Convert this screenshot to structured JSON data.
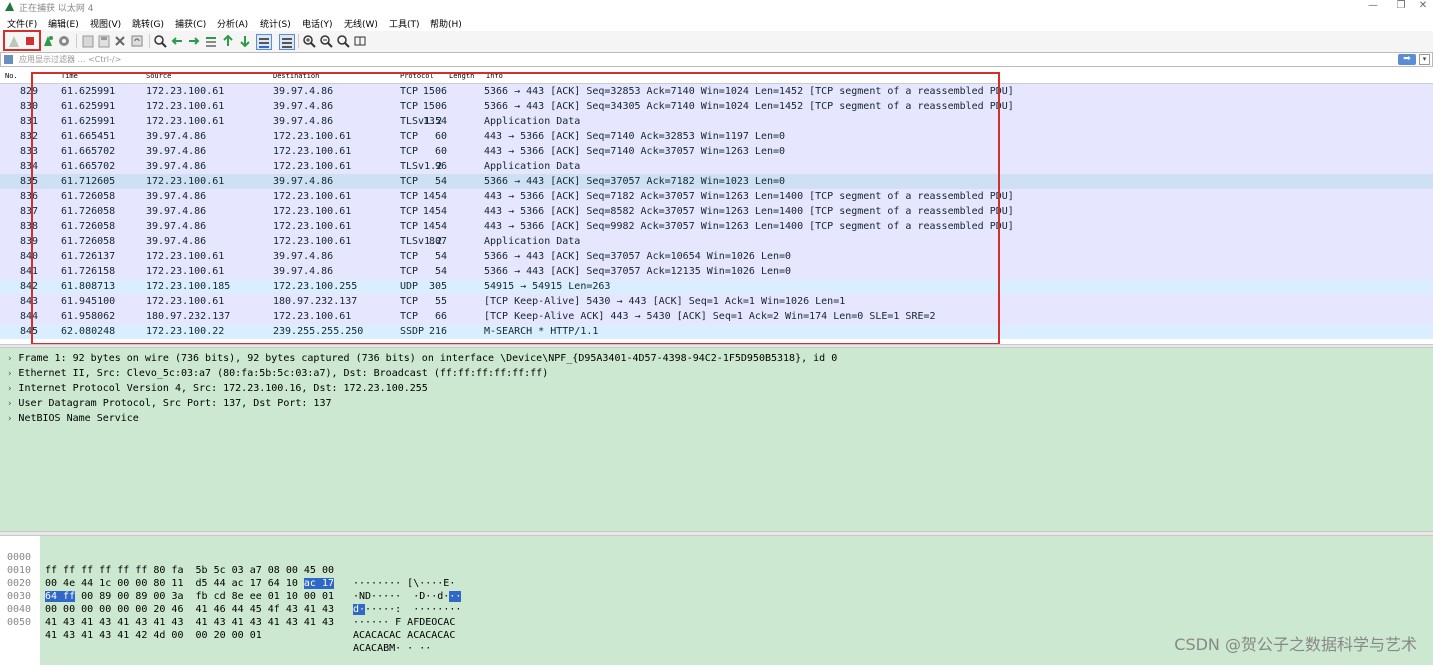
{
  "window": {
    "title": "正在捕获 以太网 4"
  },
  "menu": [
    "文件(F)",
    "编辑(E)",
    "视图(V)",
    "跳转(G)",
    "捕获(C)",
    "分析(A)",
    "统计(S)",
    "电话(Y)",
    "无线(W)",
    "工具(T)",
    "帮助(H)"
  ],
  "filter": {
    "placeholder": "应用显示过滤器 … <Ctrl-/>"
  },
  "columns": {
    "no": "No.",
    "time": "Time",
    "source": "Source",
    "destination": "Destination",
    "protocol": "Protocol",
    "length": "Length",
    "info": "Info"
  },
  "packets": [
    {
      "no": "829",
      "time": "61.625991",
      "src": "172.23.100.61",
      "dst": "39.97.4.86",
      "proto": "TCP",
      "len": "1506",
      "info": "5366 → 443 [ACK] Seq=32853 Ack=7140 Win=1024 Len=1452 [TCP segment of a reassembled PDU]",
      "color": "#e7e6ff"
    },
    {
      "no": "830",
      "time": "61.625991",
      "src": "172.23.100.61",
      "dst": "39.97.4.86",
      "proto": "TCP",
      "len": "1506",
      "info": "5366 → 443 [ACK] Seq=34305 Ack=7140 Win=1024 Len=1452 [TCP segment of a reassembled PDU]",
      "color": "#e7e6ff"
    },
    {
      "no": "831",
      "time": "61.625991",
      "src": "172.23.100.61",
      "dst": "39.97.4.86",
      "proto": "TLSv1.2",
      "len": "1354",
      "info": "Application Data",
      "color": "#e7e6ff"
    },
    {
      "no": "832",
      "time": "61.665451",
      "src": "39.97.4.86",
      "dst": "172.23.100.61",
      "proto": "TCP",
      "len": "60",
      "info": "443 → 5366 [ACK] Seq=7140 Ack=32853 Win=1197 Len=0",
      "color": "#e7e6ff"
    },
    {
      "no": "833",
      "time": "61.665702",
      "src": "39.97.4.86",
      "dst": "172.23.100.61",
      "proto": "TCP",
      "len": "60",
      "info": "443 → 5366 [ACK] Seq=7140 Ack=37057 Win=1263 Len=0",
      "color": "#e7e6ff"
    },
    {
      "no": "834",
      "time": "61.665702",
      "src": "39.97.4.86",
      "dst": "172.23.100.61",
      "proto": "TLSv1.2",
      "len": "96",
      "info": "Application Data",
      "color": "#e7e6ff"
    },
    {
      "no": "835",
      "time": "61.712605",
      "src": "172.23.100.61",
      "dst": "39.97.4.86",
      "proto": "TCP",
      "len": "54",
      "info": "5366 → 443 [ACK] Seq=37057 Ack=7182 Win=1023 Len=0",
      "color": "#cfe0f5"
    },
    {
      "no": "836",
      "time": "61.726058",
      "src": "39.97.4.86",
      "dst": "172.23.100.61",
      "proto": "TCP",
      "len": "1454",
      "info": "443 → 5366 [ACK] Seq=7182 Ack=37057 Win=1263 Len=1400 [TCP segment of a reassembled PDU]",
      "color": "#e7e6ff"
    },
    {
      "no": "837",
      "time": "61.726058",
      "src": "39.97.4.86",
      "dst": "172.23.100.61",
      "proto": "TCP",
      "len": "1454",
      "info": "443 → 5366 [ACK] Seq=8582 Ack=37057 Win=1263 Len=1400 [TCP segment of a reassembled PDU]",
      "color": "#e7e6ff"
    },
    {
      "no": "838",
      "time": "61.726058",
      "src": "39.97.4.86",
      "dst": "172.23.100.61",
      "proto": "TCP",
      "len": "1454",
      "info": "443 → 5366 [ACK] Seq=9982 Ack=37057 Win=1263 Len=1400 [TCP segment of a reassembled PDU]",
      "color": "#e7e6ff"
    },
    {
      "no": "839",
      "time": "61.726058",
      "src": "39.97.4.86",
      "dst": "172.23.100.61",
      "proto": "TLSv1.2",
      "len": "807",
      "info": "Application Data",
      "color": "#e7e6ff"
    },
    {
      "no": "840",
      "time": "61.726137",
      "src": "172.23.100.61",
      "dst": "39.97.4.86",
      "proto": "TCP",
      "len": "54",
      "info": "5366 → 443 [ACK] Seq=37057 Ack=10654 Win=1026 Len=0",
      "color": "#e7e6ff"
    },
    {
      "no": "841",
      "time": "61.726158",
      "src": "172.23.100.61",
      "dst": "39.97.4.86",
      "proto": "TCP",
      "len": "54",
      "info": "5366 → 443 [ACK] Seq=37057 Ack=12135 Win=1026 Len=0",
      "color": "#e7e6ff"
    },
    {
      "no": "842",
      "time": "61.808713",
      "src": "172.23.100.185",
      "dst": "172.23.100.255",
      "proto": "UDP",
      "len": "305",
      "info": "54915 → 54915 Len=263",
      "color": "#daeeff"
    },
    {
      "no": "843",
      "time": "61.945100",
      "src": "172.23.100.61",
      "dst": "180.97.232.137",
      "proto": "TCP",
      "len": "55",
      "info": "[TCP Keep-Alive] 5430 → 443 [ACK] Seq=1 Ack=1 Win=1026 Len=1",
      "color": "#e7e6ff"
    },
    {
      "no": "844",
      "time": "61.958062",
      "src": "180.97.232.137",
      "dst": "172.23.100.61",
      "proto": "TCP",
      "len": "66",
      "info": "[TCP Keep-Alive ACK] 443 → 5430 [ACK] Seq=1 Ack=2 Win=174 Len=0 SLE=1 SRE=2",
      "color": "#e7e6ff"
    },
    {
      "no": "845",
      "time": "62.080248",
      "src": "172.23.100.22",
      "dst": "239.255.255.250",
      "proto": "SSDP",
      "len": "216",
      "info": "M-SEARCH * HTTP/1.1",
      "color": "#daeeff"
    }
  ],
  "details": [
    "Frame 1: 92 bytes on wire (736 bits), 92 bytes captured (736 bits) on interface \\Device\\NPF_{D95A3401-4D57-4398-94C2-1F5D950B5318}, id 0",
    "Ethernet II, Src: Clevo_5c:03:a7 (80:fa:5b:5c:03:a7), Dst: Broadcast (ff:ff:ff:ff:ff:ff)",
    "Internet Protocol Version 4, Src: 172.23.100.16, Dst: 172.23.100.255",
    "User Datagram Protocol, Src Port: 137, Dst Port: 137",
    "NetBIOS Name Service"
  ],
  "bytes": [
    {
      "off": "0000",
      "hex": "ff ff ff ff ff ff 80 fa  5b 5c 03 a7 08 00 45 00",
      "asc": "········ [\\····E·"
    },
    {
      "off": "0010",
      "hex_pre": "00 4e 44 1c 00 00 80 11  d5 44 ac 17 64 10 ",
      "hex_sel": "ac 17",
      "asc_pre": "·ND·····  ·D··d·",
      "asc_sel": "··"
    },
    {
      "off": "0020",
      "hex_sel": "64 ff",
      "hex_post": " 00 89 00 89 00 3a  fb cd 8e ee 01 10 00 01",
      "asc_sel": "d·",
      "asc_post": "·····:  ········"
    },
    {
      "off": "0030",
      "hex": "00 00 00 00 00 00 20 46  41 46 44 45 4f 43 41 43",
      "asc": "······ F AFDEOCAC"
    },
    {
      "off": "0040",
      "hex": "41 43 41 43 41 43 41 43  41 43 41 43 41 43 41 43",
      "asc": "ACACACAC ACACACAC"
    },
    {
      "off": "0050",
      "hex": "41 43 41 43 41 42 4d 00  00 20 00 01",
      "asc": "ACACABM· · ··"
    }
  ],
  "watermark": "CSDN @贺公子之数据科学与艺术"
}
